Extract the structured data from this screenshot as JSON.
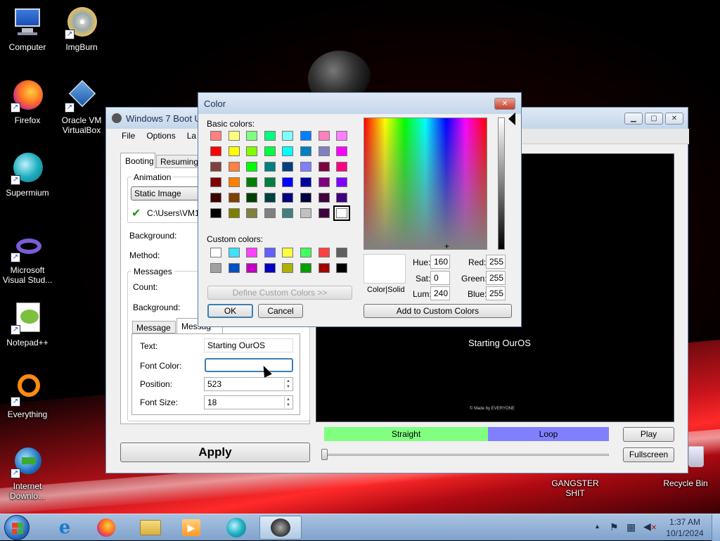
{
  "desktop": {
    "icons": [
      {
        "label": "Computer",
        "icon": "computer-icon"
      },
      {
        "label": "ImgBurn",
        "icon": "disc-icon"
      },
      {
        "label": "Firefox",
        "icon": "firefox-icon"
      },
      {
        "label": "Oracle VM VirtualBox",
        "icon": "virtualbox-icon"
      },
      {
        "label": "Supermium",
        "icon": "supermium-icon"
      },
      {
        "label": "Microsoft Visual Stud...",
        "icon": "visual-studio-icon"
      },
      {
        "label": "Notepad++",
        "icon": "notepadpp-icon"
      },
      {
        "label": "Everything",
        "icon": "everything-icon"
      },
      {
        "label": "Internet Downlo...",
        "icon": "idm-icon"
      },
      {
        "label": "GANGSTER SHIT",
        "icon": "folder-icon"
      },
      {
        "label": "Recycle Bin",
        "icon": "recycle-bin-icon"
      }
    ]
  },
  "app": {
    "title": "Windows 7 Boot Up",
    "menu": [
      "File",
      "Options",
      "La"
    ],
    "tabs": [
      "Booting",
      "Resuming"
    ],
    "animation_group": "Animation",
    "animation_select": "Static Image",
    "path": "C:\\Users\\VM1",
    "background_label": "Background:",
    "method_label": "Method:",
    "messages_group": "Messages",
    "count_label": "Count:",
    "msg_background_label": "Background:",
    "msg_tabs": [
      "Message 1",
      "Messag"
    ],
    "text_label": "Text:",
    "text_value": "Starting OurOS",
    "font_color_label": "Font Color:",
    "position_label": "Position:",
    "position_value": "523",
    "font_size_label": "Font Size:",
    "font_size_value": "18",
    "apply_label": "Apply",
    "preview_text": "Starting OurOS",
    "preview_footer": "© Made by EVERYONE",
    "straight_label": "Straight",
    "loop_label": "Loop",
    "play_label": "Play",
    "fullscreen_label": "Fullscreen"
  },
  "color_dialog": {
    "title": "Color",
    "basic_label": "Basic colors:",
    "custom_label": "Custom colors:",
    "define_label": "Define Custom Colors >>",
    "ok_label": "OK",
    "cancel_label": "Cancel",
    "color_solid_label": "Color|Solid",
    "hue_label": "Hue:",
    "hue_value": "160",
    "sat_label": "Sat:",
    "sat_value": "0",
    "lum_label": "Lum:",
    "lum_value": "240",
    "red_label": "Red:",
    "red_value": "255",
    "green_label": "Green:",
    "green_value": "255",
    "blue_label": "Blue:",
    "blue_value": "255",
    "add_custom_label": "Add to Custom Colors",
    "basic_colors": [
      "#ff8080",
      "#ffff80",
      "#80ff80",
      "#00ff80",
      "#80ffff",
      "#0080ff",
      "#ff80c0",
      "#ff80ff",
      "#ff0000",
      "#ffff00",
      "#80ff00",
      "#00ff40",
      "#00ffff",
      "#0080c0",
      "#8080c0",
      "#ff00ff",
      "#804040",
      "#ff8040",
      "#00ff00",
      "#008080",
      "#004080",
      "#8080ff",
      "#800040",
      "#ff0080",
      "#800000",
      "#ff8000",
      "#008000",
      "#008040",
      "#0000ff",
      "#0000a0",
      "#800080",
      "#8000ff",
      "#400000",
      "#804000",
      "#004000",
      "#004040",
      "#000080",
      "#000040",
      "#400040",
      "#400080",
      "#000000",
      "#808000",
      "#808040",
      "#808080",
      "#408080",
      "#c0c0c0",
      "#400040",
      "#ffffff"
    ],
    "custom_colors": [
      "#ffffff",
      "#40e0ff",
      "#ff40ff",
      "#6060ff",
      "#ffff40",
      "#40ff60",
      "#ff4040",
      "#606060",
      "#a0a0a0",
      "#0050c0",
      "#c000c0",
      "#0000c0",
      "#b0b000",
      "#00a000",
      "#a00000",
      "#000000"
    ]
  },
  "taskbar": {
    "time": "1:37 AM",
    "date": "10/1/2024"
  }
}
